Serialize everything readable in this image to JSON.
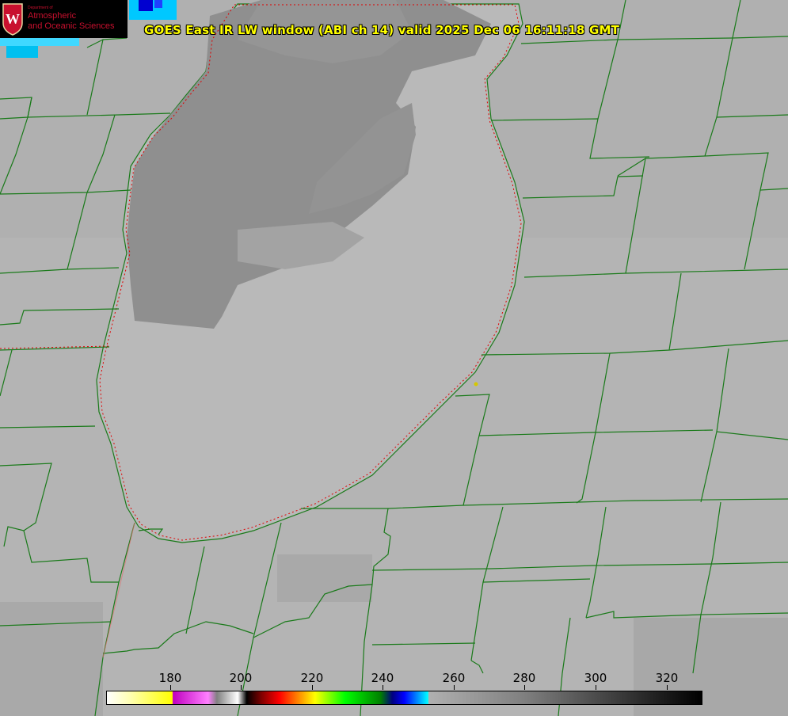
{
  "logo": {
    "department": "Department of",
    "line1": "Atmospheric",
    "line2": "and Oceanic Sciences",
    "crest_letter": "W"
  },
  "title": "GOES East IR LW window (ABI ch 14) valid 2025 Dec 06 16:11:18 GMT",
  "colorbar": {
    "ticks": [
      "180",
      "200",
      "220",
      "240",
      "260",
      "280",
      "300",
      "320"
    ]
  },
  "colors": {
    "county_lines": "#1a7a1a",
    "coastline_dotted": "#e00000",
    "title_text": "#ffff00",
    "logo_text": "#c8102e"
  }
}
